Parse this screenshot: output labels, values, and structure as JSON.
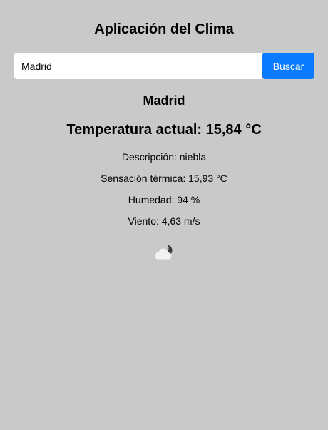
{
  "app": {
    "title": "Aplicación del Clima"
  },
  "search": {
    "value": "Madrid",
    "button_label": "Buscar"
  },
  "weather": {
    "city": "Madrid",
    "temperature_text": "Temperatura actual: 15,84 °C",
    "description_text": "Descripción: niebla",
    "feels_like_text": "Sensación térmica: 15,93 °C",
    "humidity_text": "Humedad: 94 %",
    "wind_text": "Viento: 4,63 m/s",
    "icon": "cloudy-night-icon"
  },
  "colors": {
    "background": "#c9c9c9",
    "accent": "#0a7bff",
    "input_background": "#ffffff"
  }
}
